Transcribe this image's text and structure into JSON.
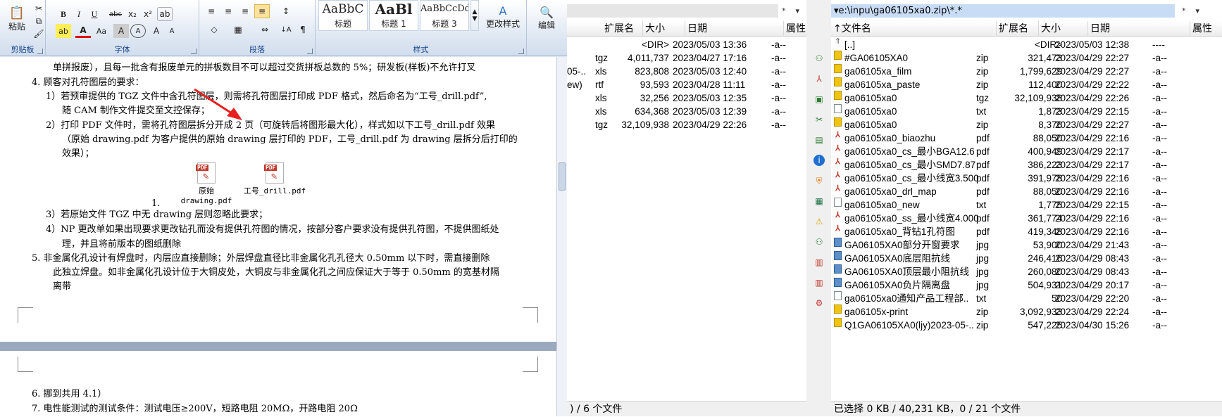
{
  "word": {
    "groups": {
      "clipboard": "剪贴板",
      "font": "字体",
      "paragraph": "段落",
      "styles": "样式"
    },
    "paste_label": "粘贴",
    "edit_label": "编辑",
    "change_styles_label": "更改样式",
    "styles": [
      {
        "sample": "AaBbC",
        "name": "标题"
      },
      {
        "sample": "AaBl",
        "name": "标题 1"
      },
      {
        "sample": "AaBbCcDd",
        "name": "标题 3"
      }
    ],
    "font_buttons": [
      "B",
      "I",
      "U",
      "abc",
      "x₂",
      "x²",
      "ab",
      "A",
      "Aa",
      "A",
      "A",
      "A",
      "A"
    ],
    "para_buttons": [
      "≡",
      "≡",
      "≡",
      "≡",
      "↕",
      "◇",
      "▦",
      "⇔",
      "↓A",
      "¶"
    ],
    "page1_lines": [
      "单拼报废），且每一批含有报废单元的拼板数目不可以超过交货拼板总数的 5%；研发板(样板)不允许打叉",
      "4.   顾客对孔符图层的要求：",
      "1）若预审提供的 TGZ 文件中含孔符图层，则需将孔符图层打印成 PDF 格式，然后命名为“工号_drill.pdf”,",
      "随 CAM 制作文件提交至文控保存；",
      "2）打印 PDF 文件时，需将孔符图层拆分开成 2 页（可旋转后将图形最大化），样式如以下工号_drill.pdf 效果",
      "（原始 drawing.pdf 为客户提供的原始 drawing 层打印的 PDF，工号_drill.pdf 为 drawing 层拆分后打印的",
      "效果）；",
      "1.",
      "3）若原始文件 TGZ 中无 drawing 层则忽略此要求；",
      "4）NP 更改单如果出现要求更改钻孔而没有提供孔符图的情况，按部分客户要求没有提供孔符图，不提供图纸处",
      "理，并且将前版本的图纸删除",
      "5.   非金属化孔设计有焊盘时，内层应直接删除；外层焊盘直径比非金属化孔孔径大 0.50mm 以下时，需直接删除",
      "此独立焊盘。如非金属化孔设计位于大铜皮处，大铜皮与非金属化孔之间应保证大于等于 0.50mm 的宽基材隔",
      "离带"
    ],
    "attachments": [
      "原始drawing.pdf",
      "工号_drill.pdf"
    ],
    "page2_lines": [
      "6.   挪到共用 4.1）",
      "7.   电性能测试的测试条件：测试电压≥200V，短路电阻 20MΩ，开路电阻 20Ω"
    ]
  },
  "left_panel": {
    "columns": [
      "扩展名",
      "大小",
      "日期",
      "属性"
    ],
    "rows": [
      {
        "name": "",
        "ext": "",
        "size": "<DIR>",
        "date": "2023/05/03 13:36",
        "attr": "-a--"
      },
      {
        "name": "",
        "ext": "tgz",
        "size": "4,011,737",
        "date": "2023/04/27 17:16",
        "attr": "-a--"
      },
      {
        "name": "05-..",
        "ext": "xls",
        "size": "823,808",
        "date": "2023/05/03 12:40",
        "attr": "-a--"
      },
      {
        "name": "ew)",
        "ext": "rtf",
        "size": "93,593",
        "date": "2023/04/28 11:11",
        "attr": "-a--"
      },
      {
        "name": "",
        "ext": "xls",
        "size": "32,256",
        "date": "2023/05/03 12:35",
        "attr": "-a--"
      },
      {
        "name": "",
        "ext": "xls",
        "size": "634,368",
        "date": "2023/05/03 12:39",
        "attr": "-a--"
      },
      {
        "name": "",
        "ext": "tgz",
        "size": "32,109,938",
        "date": "2023/04/29 22:26",
        "attr": "-a--"
      }
    ],
    "status": ") / 6 个文件"
  },
  "right_panel": {
    "path": "e:\\inpu\\ga06105xa0.zip\\*.*",
    "columns": [
      "↑文件名",
      "扩展名",
      "大小",
      "日期",
      "属性"
    ],
    "rows": [
      {
        "icon": "up",
        "name": "[..]",
        "ext": "",
        "size": "<DIR>",
        "date": "2023/05/03 12:38",
        "attr": "----"
      },
      {
        "icon": "zip",
        "name": "#GA06105XA0",
        "ext": "zip",
        "size": "321,473",
        "date": "2023/04/29 22:27",
        "attr": "-a--"
      },
      {
        "icon": "zip",
        "name": "ga06105xa_film",
        "ext": "zip",
        "size": "1,799,629",
        "date": "2023/04/29 22:27",
        "attr": "-a--"
      },
      {
        "icon": "zip",
        "name": "ga06105xa_paste",
        "ext": "zip",
        "size": "112,400",
        "date": "2023/04/29 22:22",
        "attr": "-a--"
      },
      {
        "icon": "zip",
        "name": "ga06105xa0",
        "ext": "tgz",
        "size": "32,109,938",
        "date": "2023/04/29 22:26",
        "attr": "-a--"
      },
      {
        "icon": "txt",
        "name": "ga06105xa0",
        "ext": "txt",
        "size": "1,873",
        "date": "2023/04/29 22:15",
        "attr": "-a--"
      },
      {
        "icon": "zip",
        "name": "ga06105xa0",
        "ext": "zip",
        "size": "8,376",
        "date": "2023/04/29 22:27",
        "attr": "-a--"
      },
      {
        "icon": "pdf",
        "name": "ga06105xa0_biaozhu",
        "ext": "pdf",
        "size": "88,050",
        "date": "2023/04/29 22:16",
        "attr": "-a--"
      },
      {
        "icon": "pdf",
        "name": "ga06105xa0_cs_最小BGA12.6",
        "ext": "pdf",
        "size": "400,949",
        "date": "2023/04/29 22:17",
        "attr": "-a--"
      },
      {
        "icon": "pdf",
        "name": "ga06105xa0_cs_最小SMD7.87",
        "ext": "pdf",
        "size": "386,223",
        "date": "2023/04/29 22:17",
        "attr": "-a--"
      },
      {
        "icon": "pdf",
        "name": "ga06105xa0_cs_最小线宽3.500",
        "ext": "pdf",
        "size": "391,978",
        "date": "2023/04/29 22:16",
        "attr": "-a--"
      },
      {
        "icon": "pdf",
        "name": "ga06105xa0_drl_map",
        "ext": "pdf",
        "size": "88,050",
        "date": "2023/04/29 22:16",
        "attr": "-a--"
      },
      {
        "icon": "txt",
        "name": "ga06105xa0_new",
        "ext": "txt",
        "size": "1,775",
        "date": "2023/04/29 22:15",
        "attr": "-a--"
      },
      {
        "icon": "pdf",
        "name": "ga06105xa0_ss_最小线宽4.000",
        "ext": "pdf",
        "size": "361,774",
        "date": "2023/04/29 22:16",
        "attr": "-a--"
      },
      {
        "icon": "pdf",
        "name": "ga06105xa0_背钻1孔符图",
        "ext": "pdf",
        "size": "419,348",
        "date": "2023/04/29 22:16",
        "attr": "-a--"
      },
      {
        "icon": "jpg",
        "name": "GA06105XA0部分开窗要求",
        "ext": "jpg",
        "size": "53,900",
        "date": "2023/04/29 21:43",
        "attr": "-a--"
      },
      {
        "icon": "jpg",
        "name": "GA06105XA0底层阻抗线",
        "ext": "jpg",
        "size": "246,416",
        "date": "2023/04/29 08:43",
        "attr": "-a--"
      },
      {
        "icon": "jpg",
        "name": "GA06105XA0顶层最小阻抗线",
        "ext": "jpg",
        "size": "260,080",
        "date": "2023/04/29 08:43",
        "attr": "-a--"
      },
      {
        "icon": "jpg",
        "name": "GA06105XA0负片隔离盘",
        "ext": "jpg",
        "size": "504,931",
        "date": "2023/04/29 20:17",
        "attr": "-a--"
      },
      {
        "icon": "txt",
        "name": "ga06105xa0通知产品工程部..",
        "ext": "txt",
        "size": "50",
        "date": "2023/04/29 22:20",
        "attr": "-a--"
      },
      {
        "icon": "zip",
        "name": "ga06105x-print",
        "ext": "zip",
        "size": "3,092,933",
        "date": "2023/04/29 22:24",
        "attr": "-a--"
      },
      {
        "icon": "zip",
        "name": "Q1GA06105XA0(ljy)2023-05-..",
        "ext": "zip",
        "size": "547,225",
        "date": "2023/04/30 15:26",
        "attr": "-a--"
      }
    ],
    "status": "已选择 0 KB / 40,231 KB，0 / 21 个文件"
  },
  "tool_icons": [
    "network-icon",
    "pdf-icon",
    "image-icon",
    "tool-icon",
    "photo-icon",
    "info-icon",
    "shield-icon",
    "excel-icon",
    "warning-icon",
    "network-icon",
    "folder-icon",
    "folder-icon",
    "gear-icon"
  ],
  "colors": {
    "path_active": "#c9dcf5",
    "arrow": "#e8201e",
    "accent": "#15428b"
  }
}
